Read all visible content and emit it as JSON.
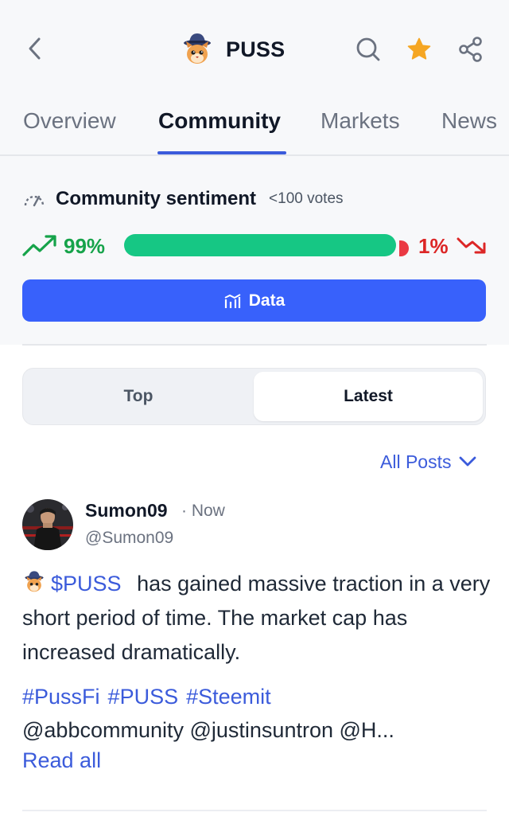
{
  "header": {
    "title": "PUSS",
    "back_icon": "chevron-left-icon",
    "search_icon": "search-icon",
    "star_icon": "star-icon",
    "share_icon": "share-icon",
    "star_color": "#f5a623"
  },
  "tabs": [
    {
      "label": "Overview"
    },
    {
      "label": "Community"
    },
    {
      "label": "Markets"
    },
    {
      "label": "News"
    }
  ],
  "active_tab": "Community",
  "sentiment": {
    "title": "Community sentiment",
    "votes": "<100 votes",
    "bullish_pct": "99%",
    "bearish_pct": "1%",
    "bullish_fraction": 0.99,
    "bullish_color": "#16c784",
    "bearish_color": "#ea3943"
  },
  "data_button": {
    "label": "Data"
  },
  "segment": {
    "top_label": "Top",
    "latest_label": "Latest",
    "selected": "Latest"
  },
  "filter": {
    "label": "All Posts"
  },
  "post": {
    "author": "Sumon09",
    "time": "· Now",
    "handle": "@Sumon09",
    "cashtag": "$PUSS",
    "text": "has gained massive traction in a very short period of time. The market cap has increased dramatically.",
    "hashtags": [
      "#PussFi",
      "#PUSS",
      "#Steemit"
    ],
    "mentions": "@abbcommunity @justinsuntron @H...",
    "read_all": "Read all"
  },
  "accent_color": "#3861fb"
}
